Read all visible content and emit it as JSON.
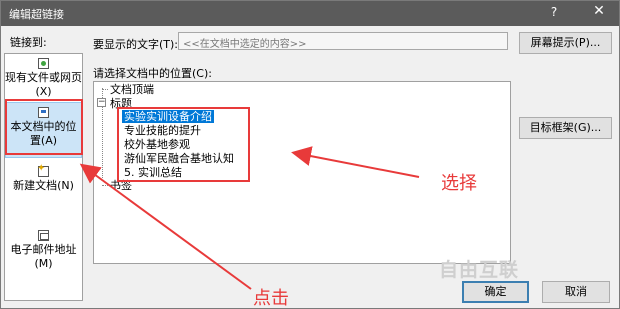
{
  "window": {
    "title": "编辑超链接",
    "help_label": "?",
    "close_label": "✕"
  },
  "left_panel": {
    "header": "链接到:",
    "items": [
      {
        "label": "现有文件或网页(X)",
        "icon": "web-page-icon"
      },
      {
        "label": "本文档中的位置(A)",
        "icon": "document-place-icon",
        "selected": true
      },
      {
        "label": "新建文档(N)",
        "icon": "new-document-icon"
      },
      {
        "label": "电子邮件地址(M)",
        "icon": "email-icon"
      }
    ]
  },
  "display_text": {
    "label": "要显示的文字(T):",
    "value": "<<在文档中选定的内容>>"
  },
  "screen_tip_button": "屏幕提示(P)...",
  "place_label": "请选择文档中的位置(C):",
  "target_frame_button": "目标框架(G)...",
  "tree": {
    "top": "文档顶端",
    "headings": "标题",
    "items": [
      "实验实训设备介绍",
      "专业技能的提升",
      "校外基地参观",
      "游仙军民融合基地认知",
      "5. 实训总结"
    ],
    "bookmarks": "书签"
  },
  "ok_button": "确定",
  "cancel_button": "取消",
  "annotations": {
    "select": "选择",
    "click": "点击"
  },
  "watermark": "自由互联",
  "colors": {
    "annotation": "#e83a3a",
    "selection": "#0078d7",
    "titlebar": "#5b5b5b"
  }
}
